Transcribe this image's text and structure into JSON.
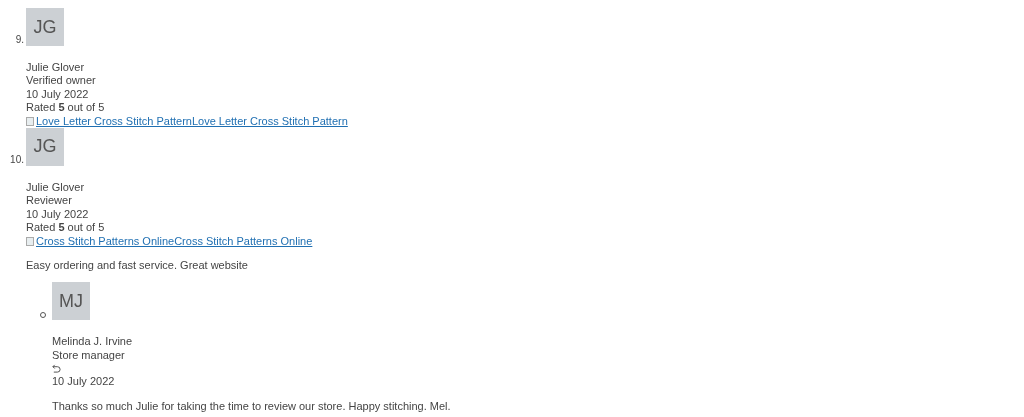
{
  "reviews": [
    {
      "number": "9.",
      "initials": "JG",
      "author": "Julie Glover",
      "role": "Verified owner",
      "date": "10 July 2022",
      "rating_text": "Rated **5** out of 5",
      "product_link": "Love Letter Cross Stitch PatternLove Letter Cross Stitch Pattern"
    },
    {
      "number": "10.",
      "initials": "JG",
      "author": "Julie Glover",
      "role": "Reviewer",
      "date": "10 July 2022",
      "rating_text": "Rated **5** out of 5",
      "product_link": "Cross Stitch Patterns OnlineCross Stitch Patterns Online",
      "comment": "Easy ordering and fast service. Great website",
      "replies": [
        {
          "initials": "MJ",
          "author": "Melinda J. Irvine",
          "role": "Store manager",
          "date": "10 July 2022",
          "comment": "Thanks so much Julie for taking the time to review our store. Happy stitching. Mel."
        }
      ]
    }
  ]
}
